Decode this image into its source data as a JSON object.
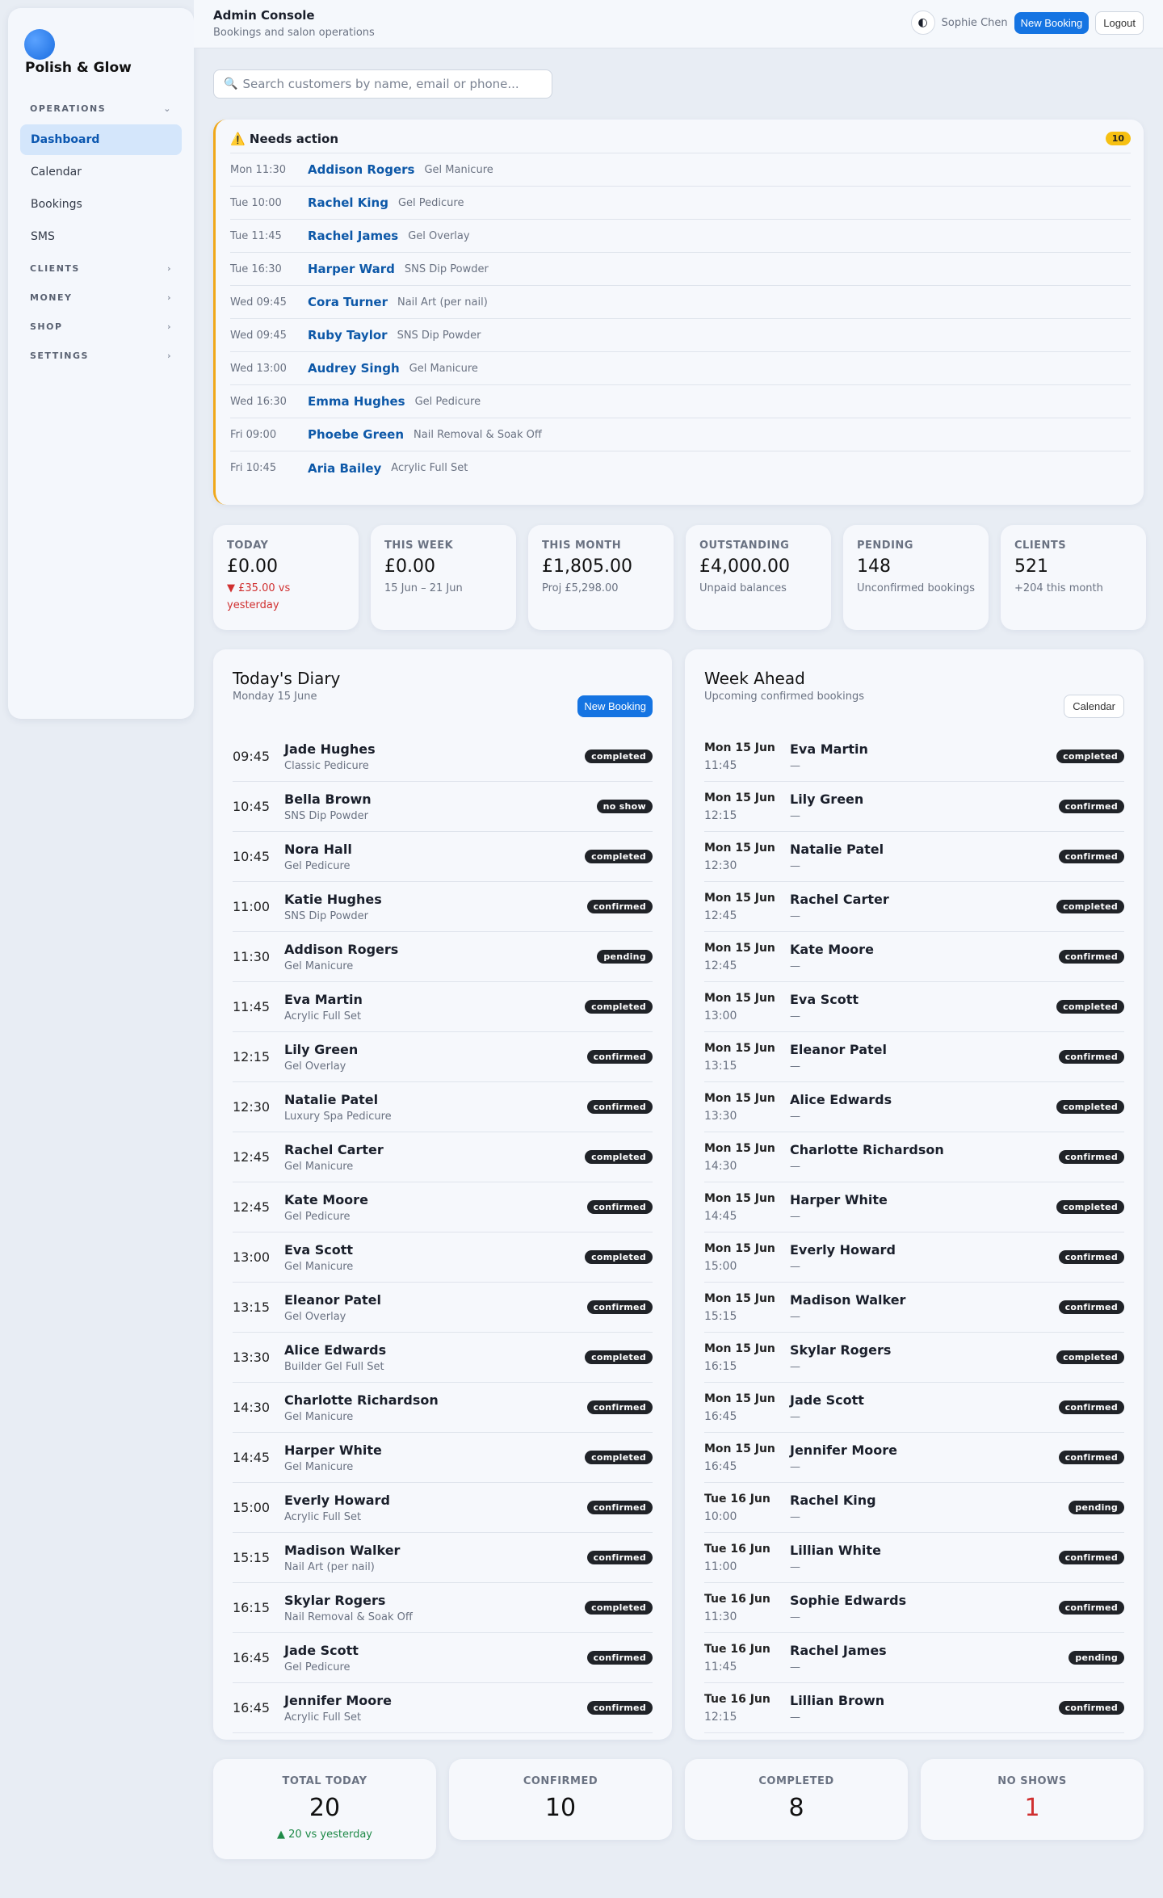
{
  "sidebar": {
    "brand": "Polish & Glow",
    "operations_label": "OPERATIONS",
    "items": [
      "Dashboard",
      "Calendar",
      "Bookings",
      "SMS"
    ],
    "sections": [
      "CLIENTS",
      "MONEY",
      "SHOP",
      "SETTINGS"
    ]
  },
  "header": {
    "title": "Admin Console",
    "subtitle": "Bookings and salon operations",
    "user": "Sophie Chen",
    "new_booking": "New Booking",
    "logout": "Logout"
  },
  "search": {
    "placeholder": "Search customers by name, email or phone..."
  },
  "needs_action": {
    "icon": "⚠️",
    "title": "Needs action",
    "count": "10",
    "rows": [
      {
        "time": "Mon 11:30",
        "name": "Addison Rogers",
        "service": "Gel Manicure"
      },
      {
        "time": "Tue 10:00",
        "name": "Rachel King",
        "service": "Gel Pedicure"
      },
      {
        "time": "Tue 11:45",
        "name": "Rachel James",
        "service": "Gel Overlay"
      },
      {
        "time": "Tue 16:30",
        "name": "Harper Ward",
        "service": "SNS Dip Powder"
      },
      {
        "time": "Wed 09:45",
        "name": "Cora Turner",
        "service": "Nail Art (per nail)"
      },
      {
        "time": "Wed 09:45",
        "name": "Ruby Taylor",
        "service": "SNS Dip Powder"
      },
      {
        "time": "Wed 13:00",
        "name": "Audrey Singh",
        "service": "Gel Manicure"
      },
      {
        "time": "Wed 16:30",
        "name": "Emma Hughes",
        "service": "Gel Pedicure"
      },
      {
        "time": "Fri 09:00",
        "name": "Phoebe Green",
        "service": "Nail Removal & Soak Off"
      },
      {
        "time": "Fri 10:45",
        "name": "Aria Bailey",
        "service": "Acrylic Full Set"
      }
    ]
  },
  "stats": [
    {
      "label": "TODAY",
      "value": "£0.00",
      "sub": "▼ £35.00 vs yesterday",
      "neg": true
    },
    {
      "label": "THIS WEEK",
      "value": "£0.00",
      "sub": "15 Jun – 21 Jun"
    },
    {
      "label": "THIS MONTH",
      "value": "£1,805.00",
      "sub": "Proj £5,298.00"
    },
    {
      "label": "OUTSTANDING",
      "value": "£4,000.00",
      "sub": "Unpaid balances"
    },
    {
      "label": "PENDING",
      "value": "148",
      "sub": "Unconfirmed bookings"
    },
    {
      "label": "CLIENTS",
      "value": "521",
      "sub": "+204 this month"
    }
  ],
  "diary": {
    "title": "Today's Diary",
    "subtitle": "Monday 15 June",
    "button": "New Booking",
    "rows": [
      {
        "time": "09:45",
        "name": "Jade Hughes",
        "service": "Classic Pedicure",
        "status": "completed"
      },
      {
        "time": "10:45",
        "name": "Bella Brown",
        "service": "SNS Dip Powder",
        "status": "no show"
      },
      {
        "time": "10:45",
        "name": "Nora Hall",
        "service": "Gel Pedicure",
        "status": "completed"
      },
      {
        "time": "11:00",
        "name": "Katie Hughes",
        "service": "SNS Dip Powder",
        "status": "confirmed"
      },
      {
        "time": "11:30",
        "name": "Addison Rogers",
        "service": "Gel Manicure",
        "status": "pending"
      },
      {
        "time": "11:45",
        "name": "Eva Martin",
        "service": "Acrylic Full Set",
        "status": "completed"
      },
      {
        "time": "12:15",
        "name": "Lily Green",
        "service": "Gel Overlay",
        "status": "confirmed"
      },
      {
        "time": "12:30",
        "name": "Natalie Patel",
        "service": "Luxury Spa Pedicure",
        "status": "confirmed"
      },
      {
        "time": "12:45",
        "name": "Rachel Carter",
        "service": "Gel Manicure",
        "status": "completed"
      },
      {
        "time": "12:45",
        "name": "Kate Moore",
        "service": "Gel Pedicure",
        "status": "confirmed"
      },
      {
        "time": "13:00",
        "name": "Eva Scott",
        "service": "Gel Manicure",
        "status": "completed"
      },
      {
        "time": "13:15",
        "name": "Eleanor Patel",
        "service": "Gel Overlay",
        "status": "confirmed"
      },
      {
        "time": "13:30",
        "name": "Alice Edwards",
        "service": "Builder Gel Full Set",
        "status": "completed"
      },
      {
        "time": "14:30",
        "name": "Charlotte Richardson",
        "service": "Gel Manicure",
        "status": "confirmed"
      },
      {
        "time": "14:45",
        "name": "Harper White",
        "service": "Gel Manicure",
        "status": "completed"
      },
      {
        "time": "15:00",
        "name": "Everly Howard",
        "service": "Acrylic Full Set",
        "status": "confirmed"
      },
      {
        "time": "15:15",
        "name": "Madison Walker",
        "service": "Nail Art (per nail)",
        "status": "confirmed"
      },
      {
        "time": "16:15",
        "name": "Skylar Rogers",
        "service": "Nail Removal & Soak Off",
        "status": "completed"
      },
      {
        "time": "16:45",
        "name": "Jade Scott",
        "service": "Gel Pedicure",
        "status": "confirmed"
      },
      {
        "time": "16:45",
        "name": "Jennifer Moore",
        "service": "Acrylic Full Set",
        "status": "confirmed"
      }
    ]
  },
  "week": {
    "title": "Week Ahead",
    "subtitle": "Upcoming confirmed bookings",
    "button": "Calendar",
    "rows": [
      {
        "date": "Mon 15 Jun",
        "time": "11:45",
        "name": "Eva Martin",
        "service": "—",
        "status": "completed"
      },
      {
        "date": "Mon 15 Jun",
        "time": "12:15",
        "name": "Lily Green",
        "service": "—",
        "status": "confirmed"
      },
      {
        "date": "Mon 15 Jun",
        "time": "12:30",
        "name": "Natalie Patel",
        "service": "—",
        "status": "confirmed"
      },
      {
        "date": "Mon 15 Jun",
        "time": "12:45",
        "name": "Rachel Carter",
        "service": "—",
        "status": "completed"
      },
      {
        "date": "Mon 15 Jun",
        "time": "12:45",
        "name": "Kate Moore",
        "service": "—",
        "status": "confirmed"
      },
      {
        "date": "Mon 15 Jun",
        "time": "13:00",
        "name": "Eva Scott",
        "service": "—",
        "status": "completed"
      },
      {
        "date": "Mon 15 Jun",
        "time": "13:15",
        "name": "Eleanor Patel",
        "service": "—",
        "status": "confirmed"
      },
      {
        "date": "Mon 15 Jun",
        "time": "13:30",
        "name": "Alice Edwards",
        "service": "—",
        "status": "completed"
      },
      {
        "date": "Mon 15 Jun",
        "time": "14:30",
        "name": "Charlotte Richardson",
        "service": "—",
        "status": "confirmed"
      },
      {
        "date": "Mon 15 Jun",
        "time": "14:45",
        "name": "Harper White",
        "service": "—",
        "status": "completed"
      },
      {
        "date": "Mon 15 Jun",
        "time": "15:00",
        "name": "Everly Howard",
        "service": "—",
        "status": "confirmed"
      },
      {
        "date": "Mon 15 Jun",
        "time": "15:15",
        "name": "Madison Walker",
        "service": "—",
        "status": "confirmed"
      },
      {
        "date": "Mon 15 Jun",
        "time": "16:15",
        "name": "Skylar Rogers",
        "service": "—",
        "status": "completed"
      },
      {
        "date": "Mon 15 Jun",
        "time": "16:45",
        "name": "Jade Scott",
        "service": "—",
        "status": "confirmed"
      },
      {
        "date": "Mon 15 Jun",
        "time": "16:45",
        "name": "Jennifer Moore",
        "service": "—",
        "status": "confirmed"
      },
      {
        "date": "Tue 16 Jun",
        "time": "10:00",
        "name": "Rachel King",
        "service": "—",
        "status": "pending"
      },
      {
        "date": "Tue 16 Jun",
        "time": "11:00",
        "name": "Lillian White",
        "service": "—",
        "status": "confirmed"
      },
      {
        "date": "Tue 16 Jun",
        "time": "11:30",
        "name": "Sophie Edwards",
        "service": "—",
        "status": "confirmed"
      },
      {
        "date": "Tue 16 Jun",
        "time": "11:45",
        "name": "Rachel James",
        "service": "—",
        "status": "pending"
      },
      {
        "date": "Tue 16 Jun",
        "time": "12:15",
        "name": "Lillian Brown",
        "service": "—",
        "status": "confirmed"
      }
    ]
  },
  "summary": [
    {
      "label": "TOTAL TODAY",
      "value": "20",
      "sub": "▲ 20 vs yesterday"
    },
    {
      "label": "CONFIRMED",
      "value": "10"
    },
    {
      "label": "COMPLETED",
      "value": "8"
    },
    {
      "label": "NO SHOWS",
      "value": "1",
      "red": true
    }
  ],
  "colors": {
    "accent": "#1574e2",
    "warning": "#f0a81a",
    "negative": "#d03030",
    "positive": "#1f8a48"
  }
}
